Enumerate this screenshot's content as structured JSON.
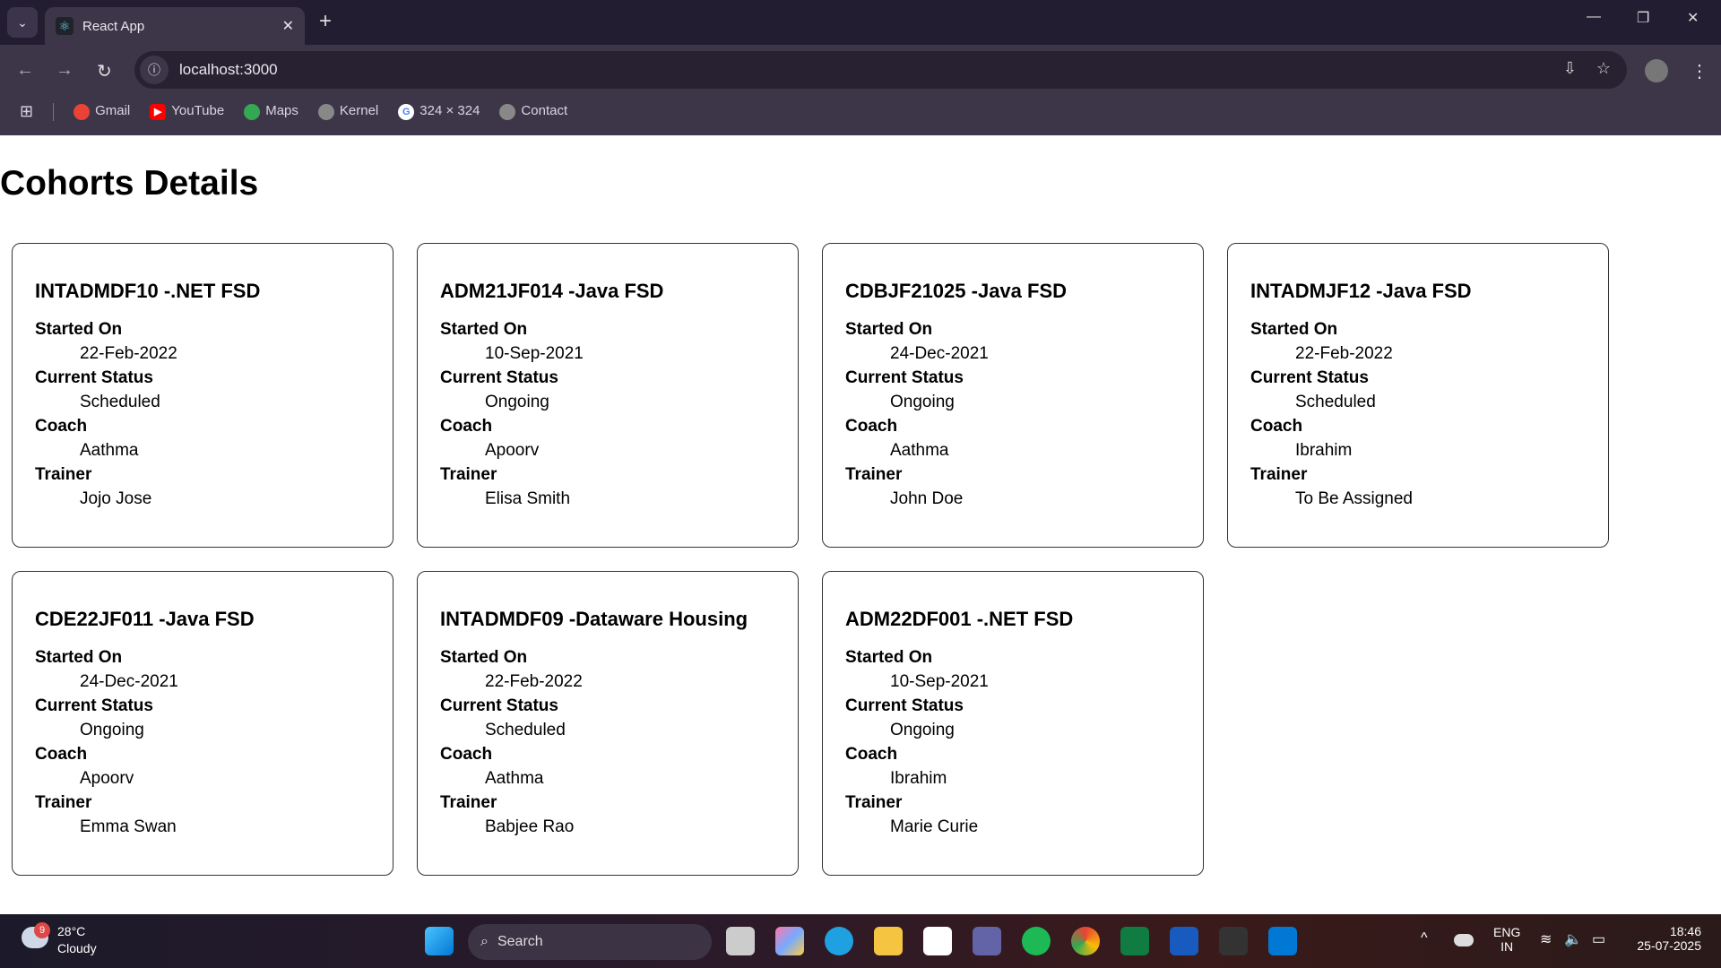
{
  "browser": {
    "tab_title": "React App",
    "url": "localhost:3000",
    "bookmarks": [
      {
        "label": "Gmail",
        "icon": "gmail-icon",
        "color": "#ea4335"
      },
      {
        "label": "YouTube",
        "icon": "youtube-icon",
        "color": "#ff0000"
      },
      {
        "label": "Maps",
        "icon": "maps-icon",
        "color": "#34a853"
      },
      {
        "label": "Kernel",
        "icon": "globe-icon",
        "color": "#888888"
      },
      {
        "label": "324 × 324",
        "icon": "google-icon",
        "color": "#4285f4"
      },
      {
        "label": "Contact",
        "icon": "globe-icon",
        "color": "#888888"
      }
    ]
  },
  "page": {
    "title": "Cohorts Details",
    "labels": {
      "started": "Started On",
      "status": "Current Status",
      "coach": "Coach",
      "trainer": "Trainer"
    },
    "cohorts": [
      {
        "title": "INTADMDF10 -.NET FSD",
        "started": "22-Feb-2022",
        "status": "Scheduled",
        "coach": "Aathma",
        "trainer": "Jojo Jose"
      },
      {
        "title": "ADM21JF014 -Java FSD",
        "started": "10-Sep-2021",
        "status": "Ongoing",
        "coach": "Apoorv",
        "trainer": "Elisa Smith"
      },
      {
        "title": "CDBJF21025 -Java FSD",
        "started": "24-Dec-2021",
        "status": "Ongoing",
        "coach": "Aathma",
        "trainer": "John Doe"
      },
      {
        "title": "INTADMJF12 -Java FSD",
        "started": "22-Feb-2022",
        "status": "Scheduled",
        "coach": "Ibrahim",
        "trainer": "To Be Assigned"
      },
      {
        "title": "CDE22JF011 -Java FSD",
        "started": "24-Dec-2021",
        "status": "Ongoing",
        "coach": "Apoorv",
        "trainer": "Emma Swan"
      },
      {
        "title": "INTADMDF09 -Dataware Housing",
        "started": "22-Feb-2022",
        "status": "Scheduled",
        "coach": "Aathma",
        "trainer": "Babjee Rao"
      },
      {
        "title": "ADM22DF001 -.NET FSD",
        "started": "10-Sep-2021",
        "status": "Ongoing",
        "coach": "Ibrahim",
        "trainer": "Marie Curie"
      }
    ]
  },
  "taskbar": {
    "weather_temp": "28°C",
    "weather_desc": "Cloudy",
    "weather_badge": "9",
    "search": "Search",
    "lang": "ENG",
    "region": "IN",
    "time": "18:46",
    "date": "25-07-2025"
  }
}
